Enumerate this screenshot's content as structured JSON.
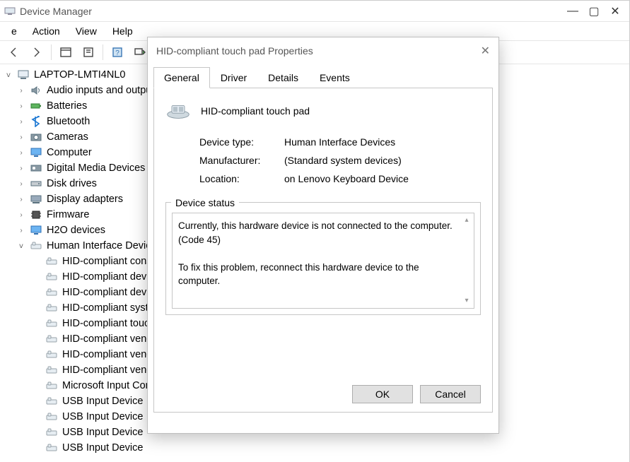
{
  "window": {
    "title": "Device Manager",
    "menu": {
      "file": "e",
      "action": "Action",
      "view": "View",
      "help": "Help"
    },
    "win_controls": {
      "min_char": "—",
      "max_char": "▢",
      "close_char": "✕"
    }
  },
  "tree": {
    "root": "LAPTOP-LMTI4NL0",
    "cats": [
      {
        "label": "Audio inputs and outpu",
        "icon": "speaker"
      },
      {
        "label": "Batteries",
        "icon": "battery"
      },
      {
        "label": "Bluetooth",
        "icon": "bluetooth"
      },
      {
        "label": "Cameras",
        "icon": "camera"
      },
      {
        "label": "Computer",
        "icon": "monitor"
      },
      {
        "label": "Digital Media Devices",
        "icon": "media"
      },
      {
        "label": "Disk drives",
        "icon": "disk"
      },
      {
        "label": "Display adapters",
        "icon": "display"
      },
      {
        "label": "Firmware",
        "icon": "chip"
      },
      {
        "label": "H2O devices",
        "icon": "monitor"
      }
    ],
    "hid_label": "Human Interface Devices",
    "hid_children": [
      "HID-compliant consu",
      "HID-compliant devic",
      "HID-compliant devic",
      "HID-compliant syste",
      "HID-compliant touch",
      "HID-compliant vend",
      "HID-compliant vend",
      "HID-compliant vend",
      "Microsoft Input Con",
      "USB Input Device",
      "USB Input Device",
      "USB Input Device",
      "USB Input Device"
    ]
  },
  "dialog": {
    "title": "HID-compliant touch pad Properties",
    "tabs": {
      "general": "General",
      "driver": "Driver",
      "details": "Details",
      "events": "Events"
    },
    "device_name": "HID-compliant touch pad",
    "labels": {
      "type": "Device type:",
      "mfr": "Manufacturer:",
      "loc": "Location:"
    },
    "values": {
      "type": "Human Interface Devices",
      "mfr": "(Standard system devices)",
      "loc": "on Lenovo Keyboard Device"
    },
    "status_heading": "Device status",
    "status_text": "Currently, this hardware device is not connected to the computer. (Code 45)\n\nTo fix this problem, reconnect this hardware device to the computer.",
    "buttons": {
      "ok": "OK",
      "cancel": "Cancel"
    }
  }
}
